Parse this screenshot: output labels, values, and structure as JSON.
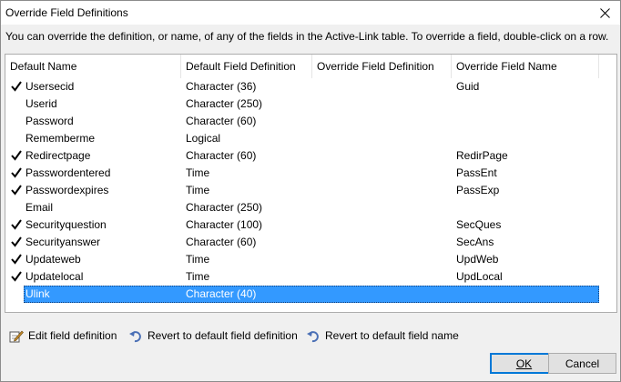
{
  "window": {
    "title": "Override Field Definitions",
    "description": "You can override the definition, or name, of any of the fields in the Active-Link table. To override a field, double-click on a row."
  },
  "columns": [
    "Default Name",
    "Default Field Definition",
    "Override Field Definition",
    "Override Field Name"
  ],
  "rows": [
    {
      "checked": true,
      "name": "Usersecid",
      "def": "Character (36)",
      "override_def": "",
      "override_name": "Guid"
    },
    {
      "checked": false,
      "name": "Userid",
      "def": "Character (250)",
      "override_def": "",
      "override_name": ""
    },
    {
      "checked": false,
      "name": "Password",
      "def": "Character (60)",
      "override_def": "",
      "override_name": ""
    },
    {
      "checked": false,
      "name": "Rememberme",
      "def": "Logical",
      "override_def": "",
      "override_name": ""
    },
    {
      "checked": true,
      "name": "Redirectpage",
      "def": "Character (60)",
      "override_def": "",
      "override_name": "RedirPage"
    },
    {
      "checked": true,
      "name": "Passwordentered",
      "def": "Time",
      "override_def": "",
      "override_name": "PassEnt"
    },
    {
      "checked": true,
      "name": "Passwordexpires",
      "def": "Time",
      "override_def": "",
      "override_name": "PassExp"
    },
    {
      "checked": false,
      "name": "Email",
      "def": "Character (250)",
      "override_def": "",
      "override_name": ""
    },
    {
      "checked": true,
      "name": "Securityquestion",
      "def": "Character (100)",
      "override_def": "",
      "override_name": "SecQues"
    },
    {
      "checked": true,
      "name": "Securityanswer",
      "def": "Character (60)",
      "override_def": "",
      "override_name": "SecAns"
    },
    {
      "checked": true,
      "name": "Updateweb",
      "def": "Time",
      "override_def": "",
      "override_name": "UpdWeb"
    },
    {
      "checked": true,
      "name": "Updatelocal",
      "def": "Time",
      "override_def": "",
      "override_name": "UpdLocal"
    },
    {
      "checked": false,
      "name": "Ulink",
      "def": "Character (40)",
      "override_def": "",
      "override_name": "",
      "selected": true
    }
  ],
  "toolbar": {
    "edit": "Edit field definition",
    "revert_def": "Revert to default field definition",
    "revert_name": "Revert to default field name"
  },
  "buttons": {
    "ok": "OK",
    "cancel": "Cancel"
  },
  "colors": {
    "selection": "#3399ff",
    "revert_icon": "#4a6fb5"
  }
}
